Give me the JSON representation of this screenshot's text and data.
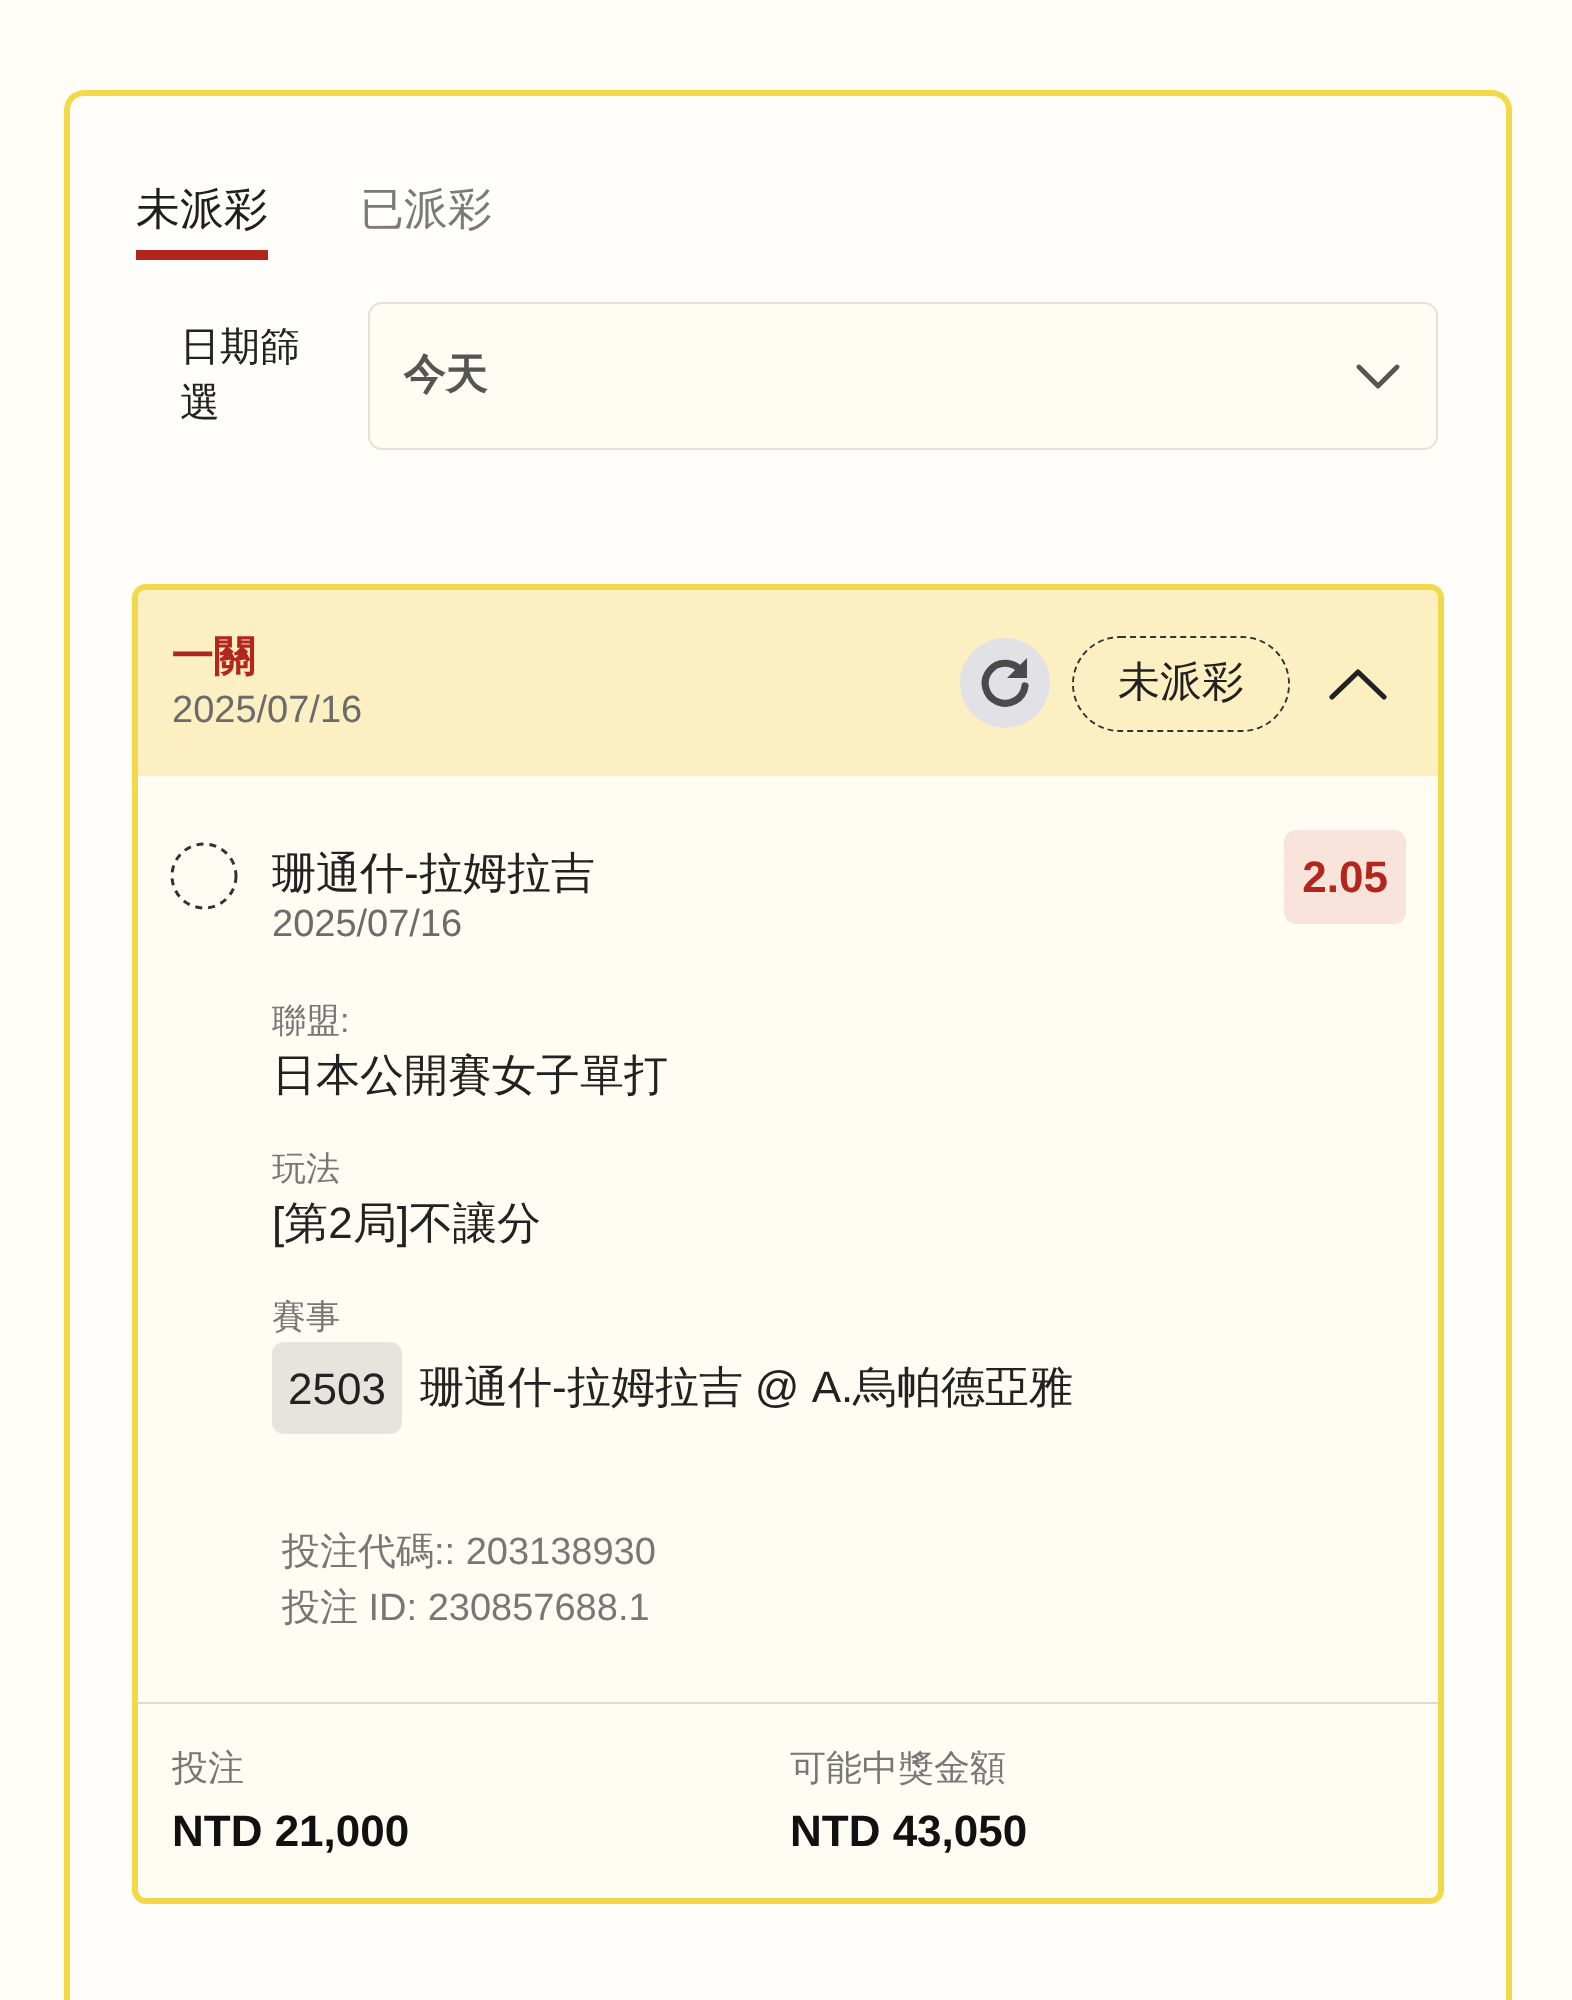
{
  "tabs": [
    {
      "label": "未派彩",
      "selected": true
    },
    {
      "label": "已派彩",
      "selected": false
    }
  ],
  "date_filter": {
    "label": "日期篩選",
    "value": "今天"
  },
  "bet_card": {
    "bet_type": "一關",
    "date": "2025/07/16",
    "status": "未派彩",
    "expanded": true,
    "selections": [
      {
        "title": "珊通什-拉姆拉吉",
        "date": "2025/07/16",
        "odds": "2.05",
        "fields": [
          {
            "kind": "text",
            "label": "聯盟:",
            "value": "日本公開賽女子單打"
          },
          {
            "kind": "text",
            "label": "玩法",
            "value": "[第2局]不讓分"
          },
          {
            "kind": "event",
            "label": "賽事",
            "code": "2503",
            "value": "珊通什-拉姆拉吉 @ A.烏帕德亞雅"
          }
        ]
      }
    ],
    "bet_code": "投注代碼:: 203138930",
    "bet_id": "投注 ID: 230857688.1",
    "summary": [
      {
        "label": "投注",
        "value": "NTD 21,000"
      },
      {
        "label": "可能中獎金額",
        "value": "NTD 43,050"
      }
    ]
  }
}
